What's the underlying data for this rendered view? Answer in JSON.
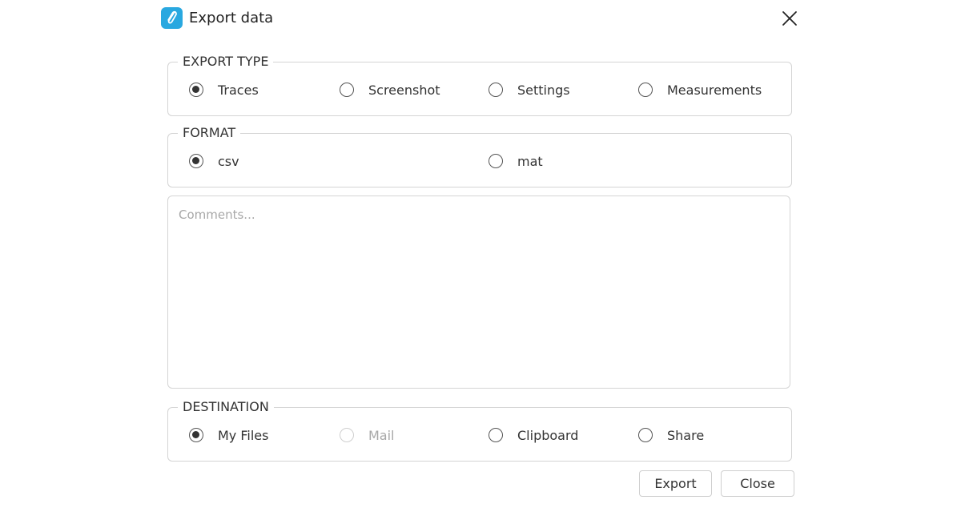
{
  "window": {
    "title": "Export data",
    "app_icon": "paperclip-logo-icon",
    "close_icon": "close-icon",
    "accent_color": "#29a8e0"
  },
  "export_type": {
    "legend": "EXPORT TYPE",
    "options": [
      {
        "label": "Traces",
        "checked": true,
        "disabled": false
      },
      {
        "label": "Screenshot",
        "checked": false,
        "disabled": false
      },
      {
        "label": "Settings",
        "checked": false,
        "disabled": false
      },
      {
        "label": "Measurements",
        "checked": false,
        "disabled": false
      }
    ]
  },
  "format": {
    "legend": "FORMAT",
    "options": [
      {
        "label": "csv",
        "checked": true,
        "disabled": false
      },
      {
        "label": "mat",
        "checked": false,
        "disabled": false
      }
    ]
  },
  "comments": {
    "placeholder": "Comments...",
    "value": ""
  },
  "destination": {
    "legend": "DESTINATION",
    "options": [
      {
        "label": "My Files",
        "checked": true,
        "disabled": false
      },
      {
        "label": "Mail",
        "checked": false,
        "disabled": true
      },
      {
        "label": "Clipboard",
        "checked": false,
        "disabled": false
      },
      {
        "label": "Share",
        "checked": false,
        "disabled": false
      }
    ]
  },
  "buttons": {
    "export_label": "Export",
    "close_label": "Close"
  }
}
